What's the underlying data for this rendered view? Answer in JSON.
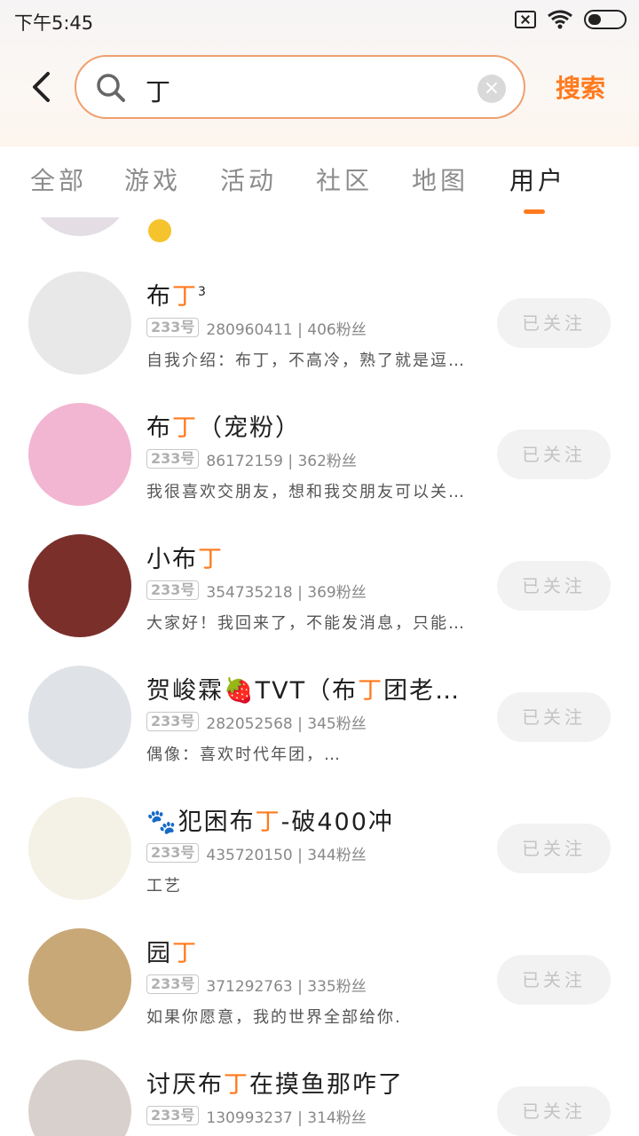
{
  "status_bar": {
    "time": "下午5:45"
  },
  "search": {
    "query": "丁",
    "submit_label": "搜索"
  },
  "tabs": [
    {
      "label": "全部",
      "active": false
    },
    {
      "label": "游戏",
      "active": false
    },
    {
      "label": "活动",
      "active": false
    },
    {
      "label": "社区",
      "active": false
    },
    {
      "label": "地图",
      "active": false
    },
    {
      "label": "用户",
      "active": true
    }
  ],
  "users": [
    {
      "name_pre": "布",
      "name_hl": "丁",
      "name_post": "",
      "name_suffix": "3",
      "id_badge": "233号",
      "meta": "280960411 | 406粉丝",
      "bio": "自我介绍：布丁，不高冷，熟了就是逗…",
      "follow_label": "已关注",
      "avatar_color": "#e8e8e8"
    },
    {
      "name_pre": "布",
      "name_hl": "丁",
      "name_post": "（宠粉）",
      "name_suffix": "",
      "id_badge": "233号",
      "meta": "86172159 | 362粉丝",
      "bio": "我很喜欢交朋友，想和我交朋友可以关…",
      "follow_label": "已关注",
      "avatar_color": "#f2b6d2"
    },
    {
      "name_pre": "小布",
      "name_hl": "丁",
      "name_post": "",
      "name_suffix": "",
      "id_badge": "233号",
      "meta": "354735218 | 369粉丝",
      "bio": "大家好！我回来了，不能发消息，只能…",
      "follow_label": "已关注",
      "avatar_color": "#7a2f2a"
    },
    {
      "name_pre": "贺峻霖🍓TVT（布",
      "name_hl": "丁",
      "name_post": "团老…",
      "name_suffix": "",
      "id_badge": "233号",
      "meta": "282052568 | 345粉丝",
      "bio": "偶像：喜欢时代年团，…",
      "follow_label": "已关注",
      "avatar_color": "#dfe3e8"
    },
    {
      "name_pre": "🐾犯困布",
      "name_hl": "丁",
      "name_post": "-破400冲",
      "name_suffix": "",
      "id_badge": "233号",
      "meta": "435720150 | 344粉丝",
      "bio": "工艺",
      "follow_label": "已关注",
      "avatar_color": "#f4f1e6"
    },
    {
      "name_pre": "园",
      "name_hl": "丁",
      "name_post": "",
      "name_suffix": "",
      "id_badge": "233号",
      "meta": "371292763 | 335粉丝",
      "bio": "如果你愿意，我的世界全部给你.",
      "follow_label": "已关注",
      "avatar_color": "#c9a878"
    },
    {
      "name_pre": "讨厌布",
      "name_hl": "丁",
      "name_post": "在摸鱼那咋了",
      "name_suffix": "",
      "id_badge": "233号",
      "meta": "130993237 | 314粉丝",
      "bio": "",
      "follow_label": "已关注",
      "avatar_color": "#d8d0cc"
    }
  ]
}
